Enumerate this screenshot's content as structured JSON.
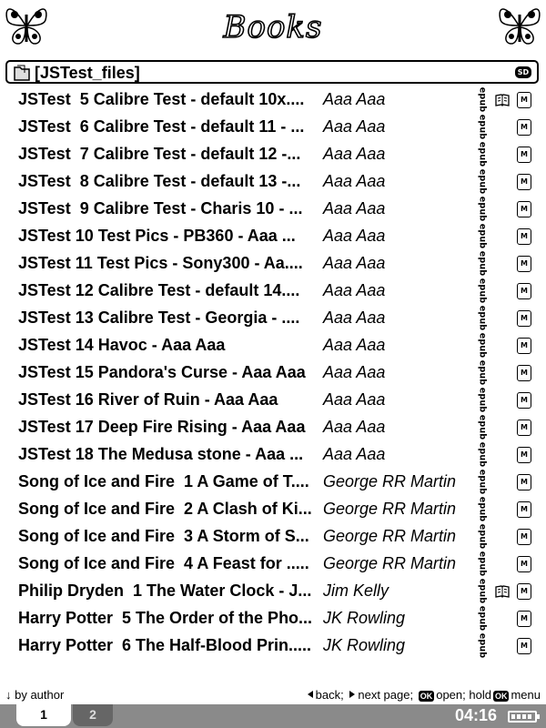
{
  "header": {
    "title": "Books"
  },
  "folder": {
    "label": "[JSTest_files]",
    "badge": "SD"
  },
  "books": [
    {
      "title": "JSTest  5 Calibre Test - default 10x....",
      "author": "Aaa Aaa",
      "format": "epub",
      "reading": true
    },
    {
      "title": "JSTest  6 Calibre Test - default 11 - ...",
      "author": "Aaa Aaa",
      "format": "epub",
      "reading": false
    },
    {
      "title": "JSTest  7 Calibre Test - default 12 -...",
      "author": "Aaa Aaa",
      "format": "epub",
      "reading": false
    },
    {
      "title": "JSTest  8 Calibre Test - default 13 -...",
      "author": "Aaa Aaa",
      "format": "epub",
      "reading": false
    },
    {
      "title": "JSTest  9 Calibre Test - Charis 10 - ...",
      "author": "Aaa Aaa",
      "format": "epub",
      "reading": false
    },
    {
      "title": "JSTest 10 Test Pics - PB360 - Aaa ...",
      "author": "Aaa Aaa",
      "format": "epub",
      "reading": false
    },
    {
      "title": "JSTest 11 Test Pics - Sony300 - Aa....",
      "author": "Aaa Aaa",
      "format": "epub",
      "reading": false
    },
    {
      "title": "JSTest 12 Calibre Test - default 14....",
      "author": "Aaa Aaa",
      "format": "epub",
      "reading": false
    },
    {
      "title": "JSTest 13 Calibre Test - Georgia - ....",
      "author": "Aaa Aaa",
      "format": "epub",
      "reading": false
    },
    {
      "title": "JSTest 14 Havoc - Aaa Aaa",
      "author": "Aaa Aaa",
      "format": "epub",
      "reading": false
    },
    {
      "title": "JSTest 15 Pandora's Curse - Aaa Aaa",
      "author": "Aaa Aaa",
      "format": "epub",
      "reading": false
    },
    {
      "title": "JSTest 16 River of Ruin - Aaa Aaa",
      "author": "Aaa Aaa",
      "format": "epub",
      "reading": false
    },
    {
      "title": "JSTest 17 Deep Fire Rising - Aaa Aaa",
      "author": "Aaa Aaa",
      "format": "epub",
      "reading": false
    },
    {
      "title": "JSTest 18 The Medusa stone - Aaa ...",
      "author": "Aaa Aaa",
      "format": "epub",
      "reading": false
    },
    {
      "title": "Song of Ice and Fire  1 A Game of T....",
      "author": "George RR Martin",
      "format": "epub",
      "reading": false
    },
    {
      "title": "Song of Ice and Fire  2 A Clash of Ki...",
      "author": "George RR Martin",
      "format": "epub",
      "reading": false
    },
    {
      "title": "Song of Ice and Fire  3 A Storm of S...",
      "author": "George RR Martin",
      "format": "epub",
      "reading": false
    },
    {
      "title": "Song of Ice and Fire  4 A Feast for .....",
      "author": "George RR Martin",
      "format": "epub",
      "reading": false
    },
    {
      "title": "Philip Dryden  1 The Water Clock - J...",
      "author": "Jim Kelly",
      "format": "epub",
      "reading": true
    },
    {
      "title": "Harry Potter  5 The Order of the Pho...",
      "author": "JK Rowling",
      "format": "epub",
      "reading": false
    },
    {
      "title": "Harry Potter  6 The Half-Blood Prin.....",
      "author": "JK Rowling",
      "format": "epub",
      "reading": false
    }
  ],
  "mem_icon_label": "M",
  "footer": {
    "sort_label": "↓ by author",
    "back": "back;",
    "next_page": "next page;",
    "ok_key": "OK",
    "open": "open;",
    "hold": "hold",
    "menu": "menu"
  },
  "tabs": [
    "1",
    "2"
  ],
  "clock": "04:16"
}
